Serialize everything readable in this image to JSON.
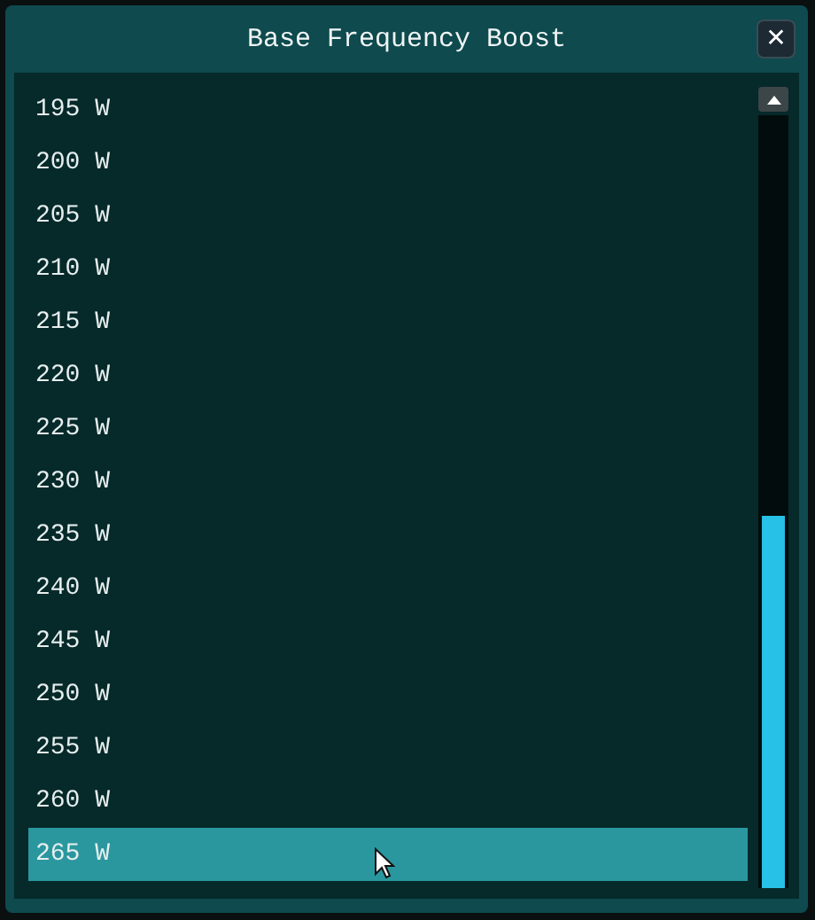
{
  "window": {
    "title": "Base Frequency Boost",
    "close": "✕"
  },
  "list": {
    "items": [
      {
        "label": "195 W",
        "selected": false
      },
      {
        "label": "200 W",
        "selected": false
      },
      {
        "label": "205 W",
        "selected": false
      },
      {
        "label": "210 W",
        "selected": false
      },
      {
        "label": "215 W",
        "selected": false
      },
      {
        "label": "220 W",
        "selected": false
      },
      {
        "label": "225 W",
        "selected": false
      },
      {
        "label": "230 W",
        "selected": false
      },
      {
        "label": "235 W",
        "selected": false
      },
      {
        "label": "240 W",
        "selected": false
      },
      {
        "label": "245 W",
        "selected": false
      },
      {
        "label": "250 W",
        "selected": false
      },
      {
        "label": "255 W",
        "selected": false
      },
      {
        "label": "260 W",
        "selected": false
      },
      {
        "label": "265 W",
        "selected": true
      }
    ]
  }
}
